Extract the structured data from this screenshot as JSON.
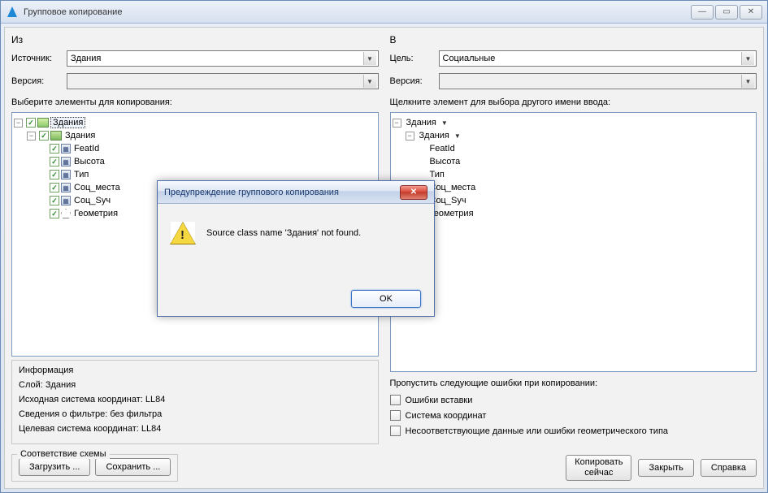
{
  "window": {
    "title": "Групповое копирование",
    "min_tip": "Свернуть",
    "max_tip": "Развернуть",
    "close_tip": "Закрыть"
  },
  "left": {
    "heading": "Из",
    "source_label": "Источник:",
    "source_value": "Здания",
    "version_label": "Версия:",
    "select_label": "Выберите элементы для копирования:",
    "tree": {
      "schema": "Здания",
      "class": "Здания",
      "fields": [
        "FeatId",
        "Высота",
        "Тип",
        "Соц_места",
        "Соц_Sуч",
        "Геометрия"
      ]
    }
  },
  "right": {
    "heading": "В",
    "target_label": "Цель:",
    "target_value": "Социальные",
    "version_label": "Версия:",
    "click_label": "Щелкните элемент для выбора другого имени ввода:",
    "tree": {
      "schema": "Здания",
      "class": "Здания",
      "fields": [
        "FeatId",
        "Высота",
        "Тип",
        "Соц_места",
        "Соц_Sуч",
        "Геометрия"
      ]
    }
  },
  "info": {
    "heading": "Информация",
    "layer": "Слой: Здания",
    "src_cs": "Исходная система координат: LL84",
    "filter": "Сведения о фильтре: без фильтра",
    "tgt_cs": "Целевая система координат: LL84"
  },
  "skip": {
    "heading": "Пропустить следующие ошибки при копировании:",
    "insert_errors": "Ошибки вставки",
    "cs": "Система координат",
    "geom": "Несоответствующие данные или ошибки геометрического типа"
  },
  "schema_map": {
    "heading": "Соответствие схемы",
    "load": "Загрузить ...",
    "save": "Сохранить ..."
  },
  "buttons": {
    "copy_now": "Копировать\nсейчас",
    "close": "Закрыть",
    "help": "Справка"
  },
  "dialog": {
    "title": "Предупреждение группового копирования",
    "message": "Source class name 'Здания' not found.",
    "ok": "OK"
  }
}
